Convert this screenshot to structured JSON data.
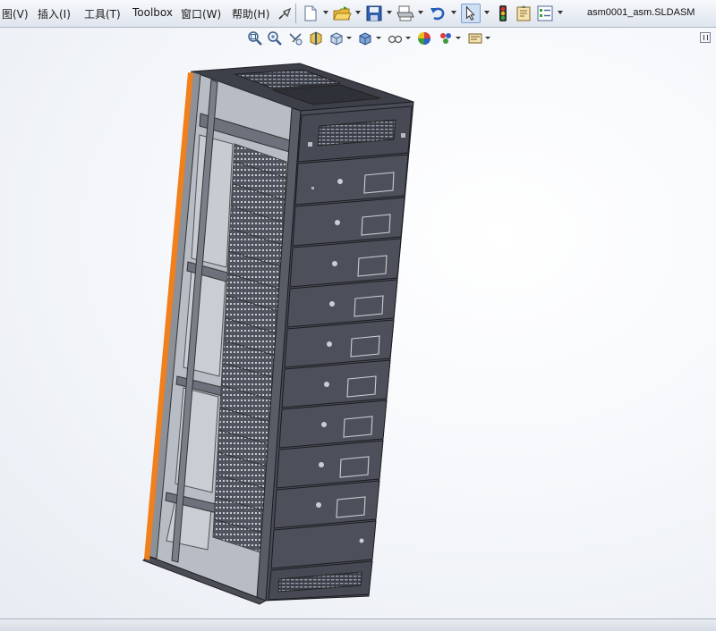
{
  "menu": {
    "items": [
      "图(V)",
      "插入(I)",
      "工具(T)",
      "Toolbox",
      "窗口(W)",
      "帮助(H)"
    ]
  },
  "toolbar": {
    "icons": [
      "pin-icon",
      "new-document-icon",
      "open-folder-icon",
      "save-icon",
      "print-icon",
      "undo-icon",
      "select-cursor-icon",
      "rebuild-traffic-light-icon",
      "file-properties-icon",
      "options-icon"
    ]
  },
  "document": {
    "title": "asm0001_asm.SLDASM"
  },
  "view_toolbar": {
    "icons": [
      "zoom-to-fit-icon",
      "zoom-to-area-icon",
      "previous-view-icon",
      "section-view-icon",
      "view-orientation-icon",
      "display-style-icon",
      "hide-show-items-icon",
      "edit-appearance-icon",
      "apply-scene-icon",
      "view-settings-icon"
    ]
  },
  "viewport": {
    "model": "server-rack-cabinet-assembly",
    "background_color": "#f4f6f9",
    "model_color": "#4a4d57",
    "highlight_edge_color": "#f07f1c"
  }
}
